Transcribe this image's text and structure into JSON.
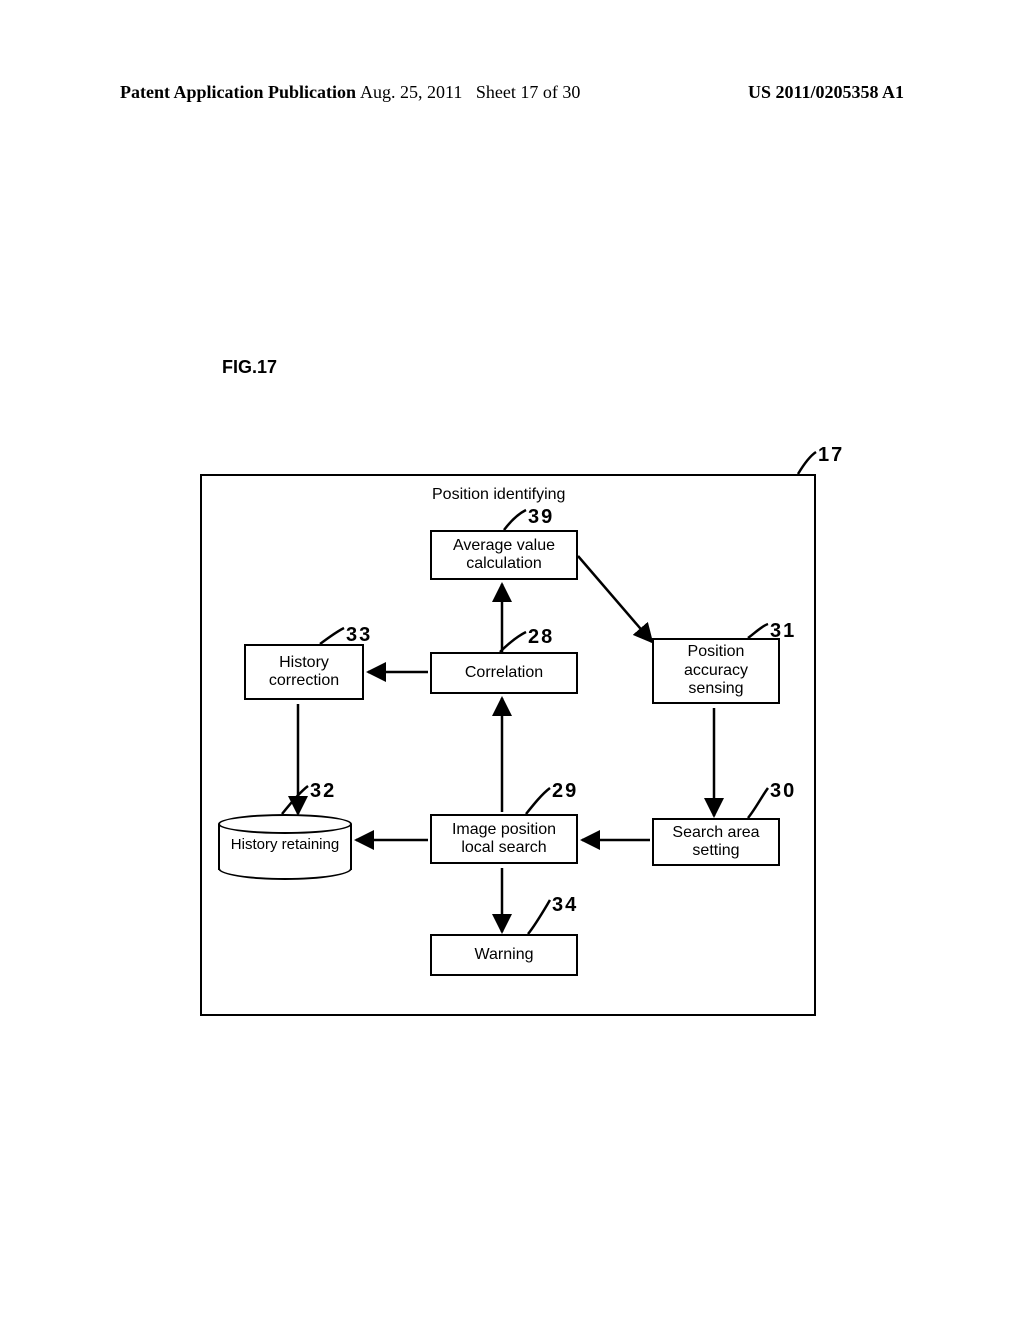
{
  "header": {
    "left": "Patent Application Publication",
    "date": "Aug. 25, 2011",
    "sheet": "Sheet 17 of 30",
    "right": "US 2011/0205358 A1"
  },
  "figure_label": "FIG.17",
  "diagram": {
    "title": "Position identifying",
    "refs": {
      "outer": "17",
      "avg": "39",
      "corr": "28",
      "hist_corr": "33",
      "pos_acc": "31",
      "hist_ret": "32",
      "img_pos": "29",
      "search": "30",
      "warn": "34"
    },
    "blocks": {
      "avg": "Average value\ncalculation",
      "corr": "Correlation",
      "hist_corr": "History\ncorrection",
      "pos_acc": "Position\naccuracy\nsensing",
      "hist_ret": "History retaining",
      "img_pos": "Image position\nlocal search",
      "search": "Search area\nsetting",
      "warn": "Warning"
    }
  }
}
